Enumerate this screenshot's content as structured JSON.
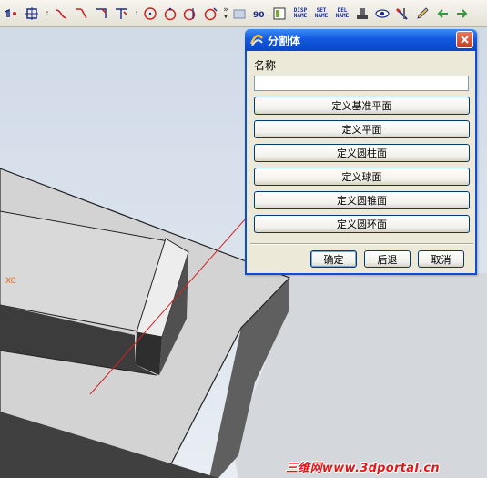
{
  "toolbar": {
    "tags": [
      {
        "line1": "DISP",
        "line2": "NAME"
      },
      {
        "line1": "SET",
        "line2": "NAME"
      },
      {
        "line1": "DEL",
        "line2": "NAME"
      }
    ],
    "rotate_label": "90"
  },
  "viewport": {
    "axis_label": "XC",
    "watermark": "三维网www.3dportal.cn"
  },
  "dialog": {
    "title": "分割体",
    "name_label": "名称",
    "name_value": "",
    "options": [
      "定义基准平面",
      "定义平面",
      "定义圆柱面",
      "定义球面",
      "定义圆锥面",
      "定义圆环面"
    ],
    "ok_label": "确定",
    "back_label": "后退",
    "cancel_label": "取消"
  },
  "colors": {
    "title_bar": "#1359df",
    "dialog_bg": "#ece9d8",
    "axis_label": "#e46b1a",
    "arrow": "#d62020"
  }
}
